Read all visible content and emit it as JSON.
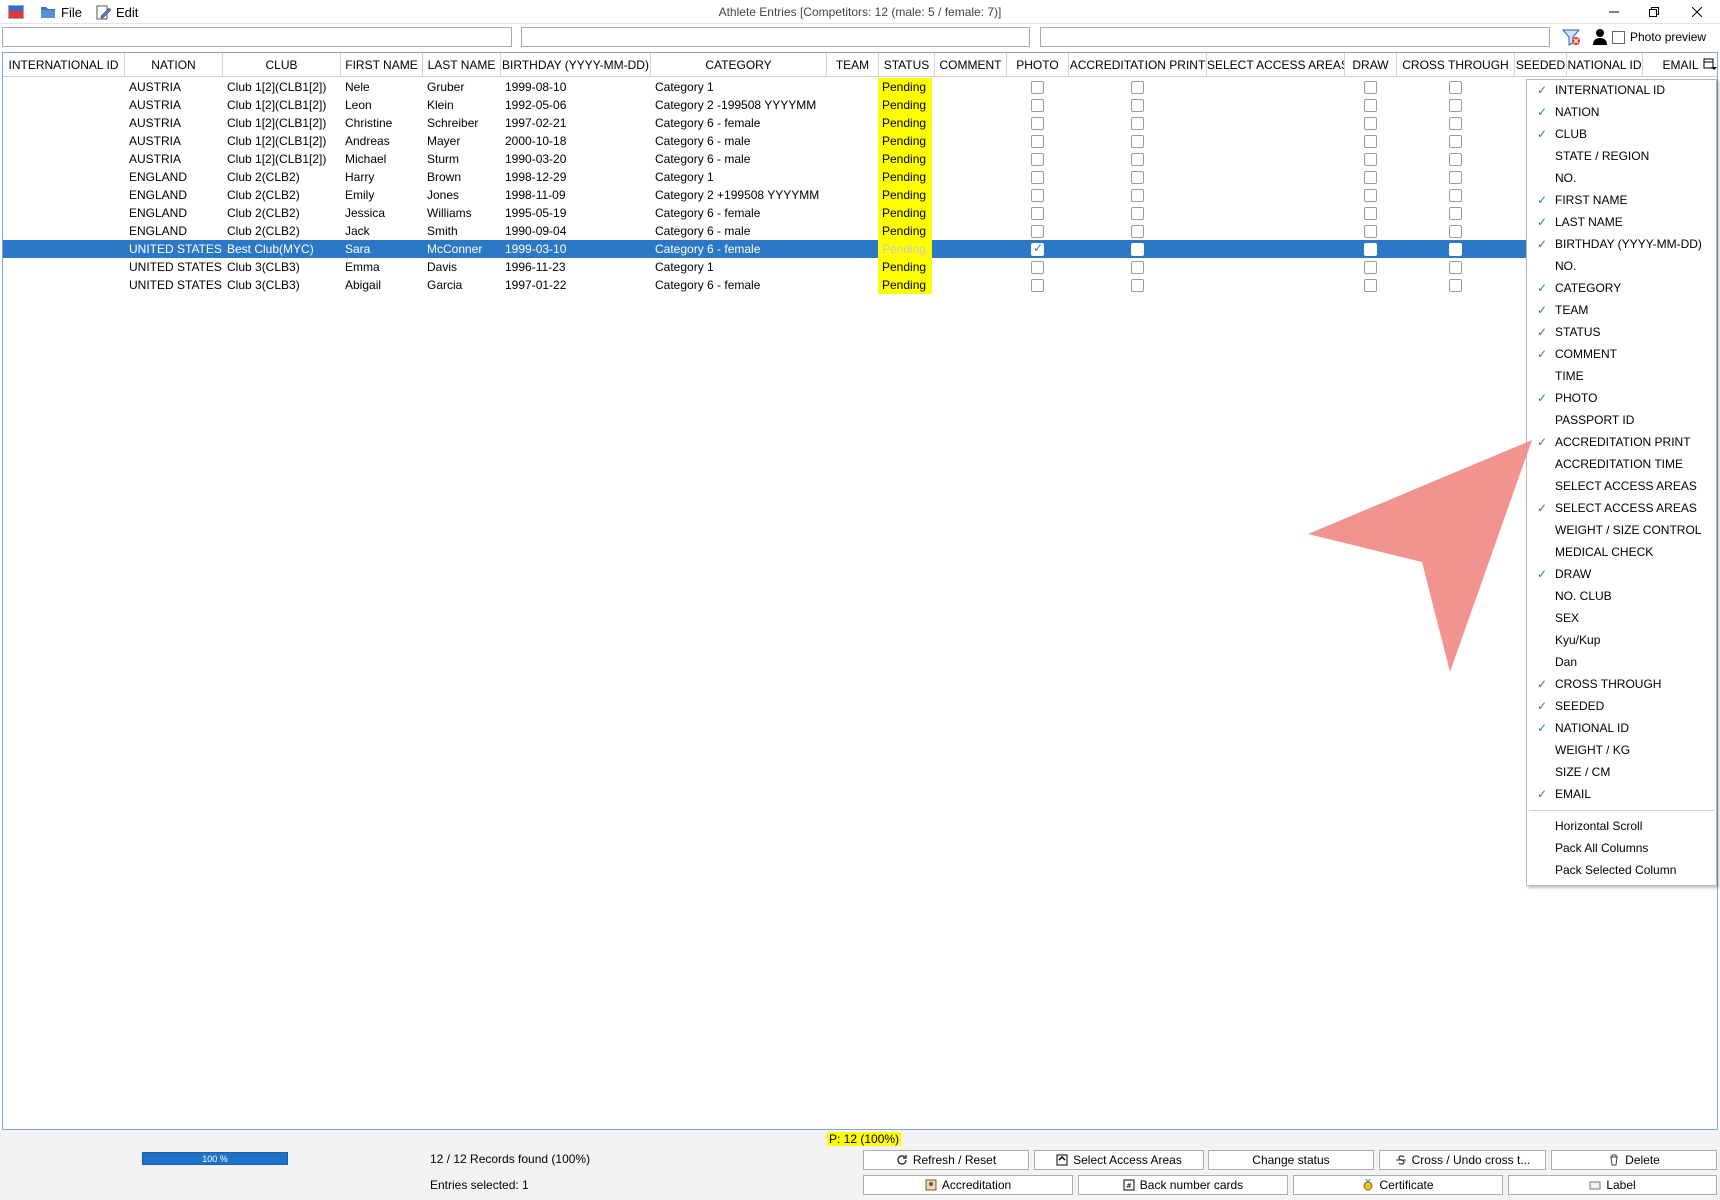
{
  "window": {
    "title": "Athlete Entries [Competitors: 12 (male: 5 / female: 7)]",
    "menu": {
      "file": "File",
      "edit": "Edit"
    }
  },
  "filters": {
    "photo_preview_label": "Photo preview"
  },
  "columns": [
    {
      "key": "intl",
      "label": "INTERNATIONAL ID"
    },
    {
      "key": "nation",
      "label": "NATION"
    },
    {
      "key": "club",
      "label": "CLUB"
    },
    {
      "key": "first",
      "label": "FIRST NAME"
    },
    {
      "key": "last",
      "label": "LAST NAME"
    },
    {
      "key": "birthday",
      "label": "BIRTHDAY (YYYY-MM-DD)"
    },
    {
      "key": "category",
      "label": "CATEGORY"
    },
    {
      "key": "team",
      "label": "TEAM"
    },
    {
      "key": "status",
      "label": "STATUS"
    },
    {
      "key": "comment",
      "label": "COMMENT"
    },
    {
      "key": "photo",
      "label": "PHOTO"
    },
    {
      "key": "accr",
      "label": "ACCREDITATION PRINT"
    },
    {
      "key": "areas",
      "label": "SELECT ACCESS AREAS"
    },
    {
      "key": "draw",
      "label": "DRAW"
    },
    {
      "key": "cross",
      "label": "CROSS THROUGH"
    },
    {
      "key": "seeded",
      "label": "SEEDED"
    },
    {
      "key": "natid",
      "label": "NATIONAL ID"
    },
    {
      "key": "email",
      "label": "EMAIL"
    }
  ],
  "rows": [
    {
      "nation": "AUSTRIA",
      "club": "Club 1[2](CLB1[2])",
      "first": "Nele",
      "last": "Gruber",
      "birthday": "1999-08-10",
      "category": "Category 1",
      "status": "Pending",
      "photo": false,
      "selected": false
    },
    {
      "nation": "AUSTRIA",
      "club": "Club 1[2](CLB1[2])",
      "first": "Leon",
      "last": "Klein",
      "birthday": "1992-05-06",
      "category": "Category 2 -199508 YYYYMM",
      "status": "Pending",
      "photo": false,
      "selected": false
    },
    {
      "nation": "AUSTRIA",
      "club": "Club 1[2](CLB1[2])",
      "first": "Christine",
      "last": "Schreiber",
      "birthday": "1997-02-21",
      "category": "Category 6 - female",
      "status": "Pending",
      "photo": false,
      "selected": false
    },
    {
      "nation": "AUSTRIA",
      "club": "Club 1[2](CLB1[2])",
      "first": "Andreas",
      "last": "Mayer",
      "birthday": "2000-10-18",
      "category": "Category 6 - male",
      "status": "Pending",
      "photo": false,
      "selected": false
    },
    {
      "nation": "AUSTRIA",
      "club": "Club 1[2](CLB1[2])",
      "first": "Michael",
      "last": "Sturm",
      "birthday": "1990-03-20",
      "category": "Category 6 - male",
      "status": "Pending",
      "photo": false,
      "selected": false
    },
    {
      "nation": "ENGLAND",
      "club": "Club 2(CLB2)",
      "first": "Harry",
      "last": "Brown",
      "birthday": "1998-12-29",
      "category": "Category 1",
      "status": "Pending",
      "photo": false,
      "selected": false
    },
    {
      "nation": "ENGLAND",
      "club": "Club 2(CLB2)",
      "first": "Emily",
      "last": "Jones",
      "birthday": "1998-11-09",
      "category": "Category 2 +199508 YYYYMM",
      "status": "Pending",
      "photo": false,
      "selected": false
    },
    {
      "nation": "ENGLAND",
      "club": "Club 2(CLB2)",
      "first": "Jessica",
      "last": "Williams",
      "birthday": "1995-05-19",
      "category": "Category 6 - female",
      "status": "Pending",
      "photo": false,
      "selected": false
    },
    {
      "nation": "ENGLAND",
      "club": "Club 2(CLB2)",
      "first": "Jack",
      "last": "Smith",
      "birthday": "1990-09-04",
      "category": "Category 6 - male",
      "status": "Pending",
      "photo": false,
      "selected": false
    },
    {
      "nation": "UNITED STATES",
      "club": "Best Club(MYC)",
      "first": "Sara",
      "last": "McConner",
      "birthday": "1999-03-10",
      "category": "Category 6 - female",
      "status": "Pending",
      "photo": true,
      "selected": true
    },
    {
      "nation": "UNITED STATES",
      "club": "Club 3(CLB3)",
      "first": "Emma",
      "last": "Davis",
      "birthday": "1996-11-23",
      "category": "Category 1",
      "status": "Pending",
      "photo": false,
      "selected": false
    },
    {
      "nation": "UNITED STATES",
      "club": "Club 3(CLB3)",
      "first": "Abigail",
      "last": "Garcia",
      "birthday": "1997-01-22",
      "category": "Category 6 - female",
      "status": "Pending",
      "photo": false,
      "selected": false
    }
  ],
  "column_menu": {
    "items": [
      {
        "label": "INTERNATIONAL ID",
        "checked": true
      },
      {
        "label": "NATION",
        "checked": true
      },
      {
        "label": "CLUB",
        "checked": true
      },
      {
        "label": "STATE / REGION",
        "checked": false
      },
      {
        "label": "NO.",
        "checked": false
      },
      {
        "label": "FIRST NAME",
        "checked": true
      },
      {
        "label": "LAST NAME",
        "checked": true
      },
      {
        "label": "BIRTHDAY (YYYY-MM-DD)",
        "checked": true
      },
      {
        "label": "NO.",
        "checked": false
      },
      {
        "label": "CATEGORY",
        "checked": true
      },
      {
        "label": "TEAM",
        "checked": true
      },
      {
        "label": "STATUS",
        "checked": true
      },
      {
        "label": "COMMENT",
        "checked": true
      },
      {
        "label": "TIME",
        "checked": false
      },
      {
        "label": "PHOTO",
        "checked": true
      },
      {
        "label": "PASSPORT ID",
        "checked": false
      },
      {
        "label": "ACCREDITATION PRINT",
        "checked": true
      },
      {
        "label": "ACCREDITATION TIME",
        "checked": false
      },
      {
        "label": "SELECT ACCESS AREAS",
        "checked": false
      },
      {
        "label": "SELECT ACCESS AREAS",
        "checked": true
      },
      {
        "label": "WEIGHT / SIZE CONTROL",
        "checked": false
      },
      {
        "label": "MEDICAL CHECK",
        "checked": false
      },
      {
        "label": "DRAW",
        "checked": true
      },
      {
        "label": "NO. CLUB",
        "checked": false
      },
      {
        "label": "SEX",
        "checked": false
      },
      {
        "label": "Kyu/Kup",
        "checked": false
      },
      {
        "label": "Dan",
        "checked": false
      },
      {
        "label": "CROSS THROUGH",
        "checked": true
      },
      {
        "label": "SEEDED",
        "checked": true
      },
      {
        "label": "NATIONAL ID",
        "checked": true
      },
      {
        "label": "WEIGHT / KG",
        "checked": false
      },
      {
        "label": "SIZE / CM",
        "checked": false
      },
      {
        "label": "EMAIL",
        "checked": true
      }
    ],
    "actions": [
      "Horizontal Scroll",
      "Pack All Columns",
      "Pack Selected Column"
    ]
  },
  "status": {
    "p_count": "P: 12 (100%)",
    "progress_label": "100 %",
    "progress_fraction": 1.0,
    "records_found": "12 / 12 Records found (100%)",
    "entries_selected": "Entries selected: 1"
  },
  "buttons": {
    "refresh": "Refresh / Reset",
    "select_areas": "Select Access Areas",
    "change_status": "Change status",
    "cross": "Cross / Undo cross t...",
    "delete": "Delete",
    "accreditation": "Accreditation",
    "back_number": "Back number cards",
    "certificate": "Certificate",
    "label": "Label"
  },
  "colors": {
    "selection": "#2b79c6",
    "status_highlight": "#ffff00",
    "arrow": "#f08a86",
    "progress": "#1e73c8"
  }
}
